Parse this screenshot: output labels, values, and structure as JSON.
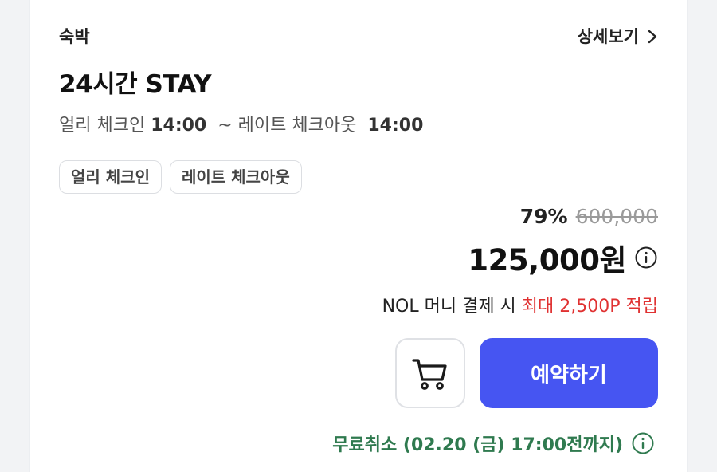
{
  "header": {
    "category": "숙박",
    "detail_link": "상세보기"
  },
  "product": {
    "title": "24시간 STAY",
    "early_checkin_label": "얼리 체크인",
    "checkin_time": "14:00",
    "separator": "~",
    "late_checkout_label": "레이트 체크아웃",
    "checkout_time": "14:00"
  },
  "tags": [
    "얼리 체크인",
    "레이트 체크아웃"
  ],
  "pricing": {
    "discount": "79%",
    "original_price": "600,000",
    "price": "125,000원"
  },
  "points": {
    "prefix": "NOL 머니 결제 시",
    "highlight": "최대 2,500P 적립"
  },
  "actions": {
    "reserve_label": "예약하기"
  },
  "cancellation": {
    "text": "무료취소 (02.20 (금) 17:00전까지)"
  },
  "colors": {
    "primary": "#4655f2",
    "points_highlight": "#e03131",
    "cancellation": "#2f7a4f"
  },
  "icons": [
    "chevron-right-icon",
    "info-icon",
    "cart-icon",
    "info-icon"
  ]
}
